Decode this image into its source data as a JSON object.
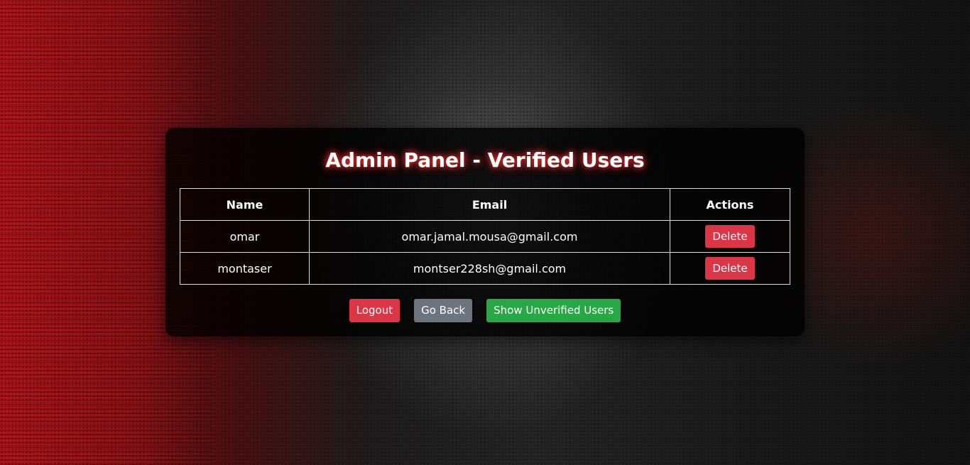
{
  "panel": {
    "title": "Admin Panel - Verified Users"
  },
  "table": {
    "headers": {
      "name": "Name",
      "email": "Email",
      "actions": "Actions"
    },
    "rows": [
      {
        "name": "omar",
        "email": "omar.jamal.mousa@gmail.com",
        "action_label": "Delete"
      },
      {
        "name": "montaser",
        "email": "montser228sh@gmail.com",
        "action_label": "Delete"
      }
    ]
  },
  "buttons": {
    "logout": "Logout",
    "go_back": "Go Back",
    "show_unverified": "Show Unverified Users"
  },
  "colors": {
    "danger": "#dc3545",
    "secondary": "#6c757d",
    "success": "#28a745",
    "title_glow": "#ff2d2d"
  }
}
